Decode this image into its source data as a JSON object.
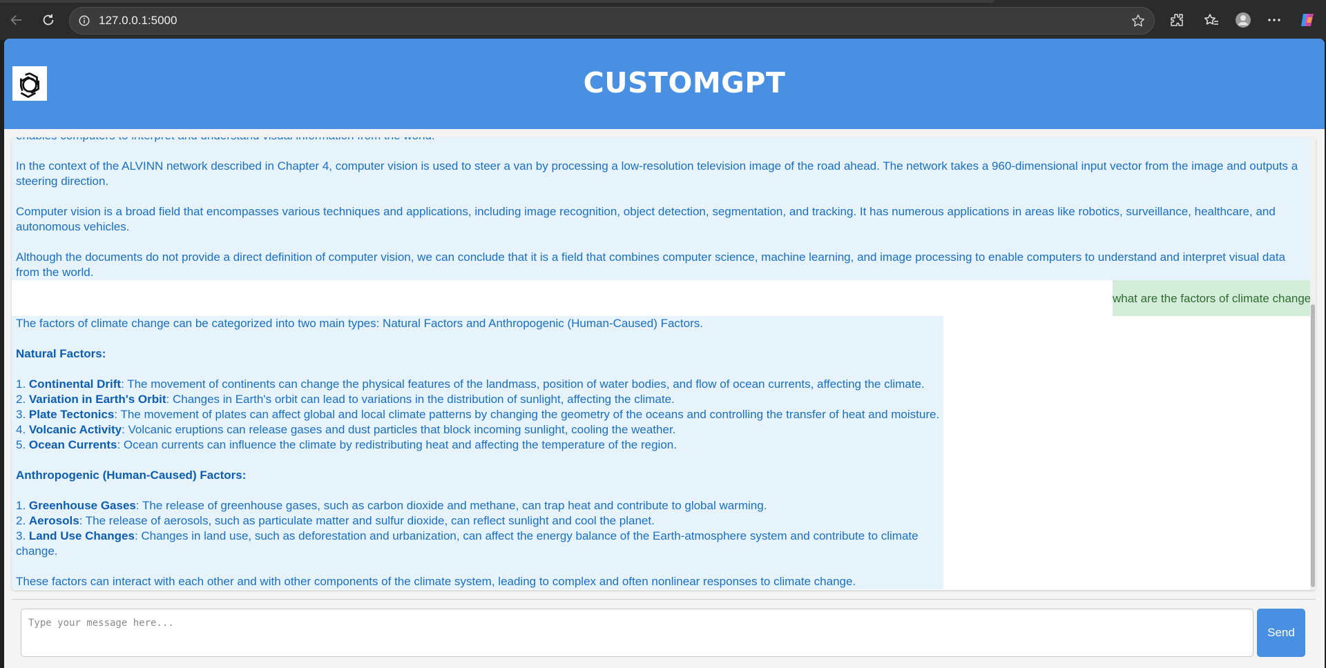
{
  "browser": {
    "url": "127.0.0.1:5000"
  },
  "app": {
    "title": "CUSTOMGPT"
  },
  "chat": {
    "previous_answer": [
      "enables computers to interpret and understand visual information from the world.",
      "In the context of the ALVINN network described in Chapter 4, computer vision is used to steer a van by processing a low-resolution television image of the road ahead. The network takes a 960-dimensional input vector from the image and outputs a steering direction.",
      "Computer vision is a broad field that encompasses various techniques and applications, including image recognition, object detection, segmentation, and tracking. It has numerous applications in areas like robotics, surveillance, healthcare, and autonomous vehicles.",
      "Although the documents do not provide a direct definition of computer vision, we can conclude that it is a field that combines computer science, machine learning, and image processing to enable computers to understand and interpret visual data from the world."
    ],
    "user_question": "what are the factors of climate change",
    "answer": {
      "intro": "The factors of climate change can be categorized into two main types: Natural Factors and Anthropogenic (Human-Caused) Factors.",
      "natural_heading": "Natural Factors:",
      "natural": [
        {
          "num": "1. ",
          "term": "Continental Drift",
          "desc": ": The movement of continents can change the physical features of the landmass, position of water bodies, and flow of ocean currents, affecting the climate."
        },
        {
          "num": "2. ",
          "term": "Variation in Earth's Orbit",
          "desc": ": Changes in Earth's orbit can lead to variations in the distribution of sunlight, affecting the climate."
        },
        {
          "num": "3. ",
          "term": "Plate Tectonics",
          "desc": ": The movement of plates can affect global and local climate patterns by changing the geometry of the oceans and controlling the transfer of heat and moisture."
        },
        {
          "num": "4. ",
          "term": "Volcanic Activity",
          "desc": ": Volcanic eruptions can release gases and dust particles that block incoming sunlight, cooling the weather."
        },
        {
          "num": "5. ",
          "term": "Ocean Currents",
          "desc": ": Ocean currents can influence the climate by redistributing heat and affecting the temperature of the region."
        }
      ],
      "anthro_heading": "Anthropogenic (Human-Caused) Factors:",
      "anthropogenic": [
        {
          "num": "1. ",
          "term": "Greenhouse Gases",
          "desc": ": The release of greenhouse gases, such as carbon dioxide and methane, can trap heat and contribute to global warming."
        },
        {
          "num": "2. ",
          "term": "Aerosols",
          "desc": ": The release of aerosols, such as particulate matter and sulfur dioxide, can reflect sunlight and cool the planet."
        },
        {
          "num": "3. ",
          "term": "Land Use Changes",
          "desc": ": Changes in land use, such as deforestation and urbanization, can affect the energy balance of the Earth-atmosphere system and contribute to climate change."
        }
      ],
      "conclusion": "These factors can interact with each other and with other components of the climate system, leading to complex and often nonlinear responses to climate change."
    }
  },
  "input": {
    "placeholder": "Type your message here...",
    "value": ""
  },
  "send_label": "Send",
  "colors": {
    "header": "#4a90e2",
    "bot_bg": "#e6f3fb",
    "bot_text": "#1a6fc4",
    "user_bg": "#d4edda",
    "user_text": "#2e6b2e"
  }
}
